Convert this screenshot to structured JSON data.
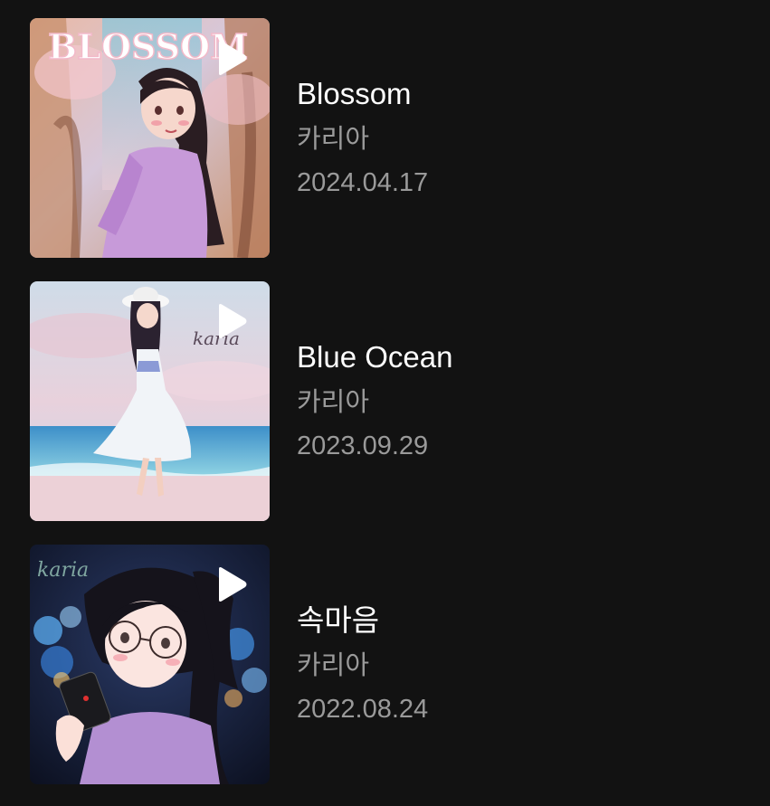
{
  "albums": [
    {
      "title": "Blossom",
      "artist": "카리아",
      "date": "2024.04.17",
      "cover_text": "BLOSSOM",
      "icon": "play-icon"
    },
    {
      "title": "Blue Ocean",
      "artist": "카리아",
      "date": "2023.09.29",
      "cover_text": "karia",
      "icon": "play-icon"
    },
    {
      "title": "속마음",
      "artist": "카리아",
      "date": "2022.08.24",
      "cover_text": "karia",
      "icon": "play-icon"
    }
  ],
  "colors": {
    "background": "#121212",
    "title": "#ffffff",
    "secondary": "#9a9a9a"
  }
}
